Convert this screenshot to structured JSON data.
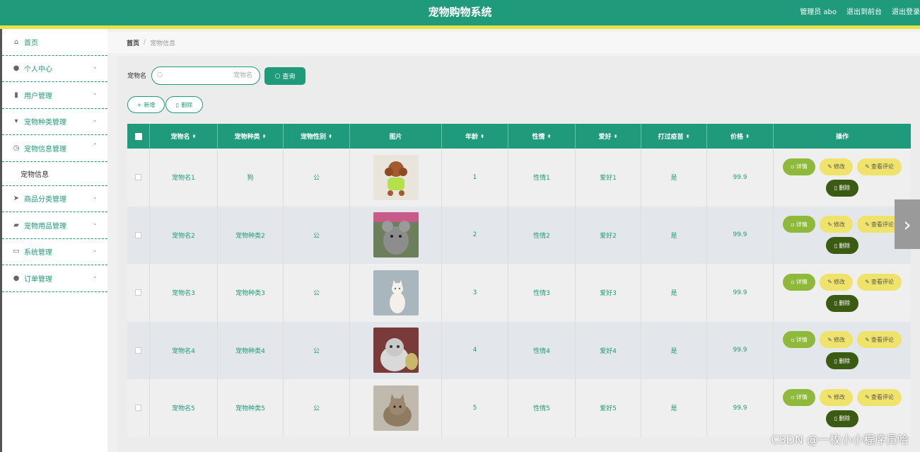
{
  "header": {
    "title": "宠物购物系统",
    "admin": "管理员 abo",
    "back_front": "退出到前台",
    "logout": "退出登录",
    "accent": "#1f9a7a",
    "stripe": "#e8e24a"
  },
  "sidebar": {
    "items": [
      {
        "label": "首页",
        "icon": "home-icon"
      },
      {
        "label": "个人中心",
        "icon": "user-icon"
      },
      {
        "label": "用户管理",
        "icon": "users-icon"
      },
      {
        "label": "宠物种类管理",
        "icon": "category-icon"
      },
      {
        "label": "宠物信息管理",
        "icon": "clock-icon"
      },
      {
        "label": "宠物信息",
        "icon": ""
      },
      {
        "label": "商品分类管理",
        "icon": "send-icon"
      },
      {
        "label": "宠物用品管理",
        "icon": "goods-icon"
      },
      {
        "label": "系统管理",
        "icon": "chat-icon"
      },
      {
        "label": "订单管理",
        "icon": "order-icon"
      }
    ]
  },
  "breadcrumb": {
    "home": "首页",
    "sep": "/",
    "current": "宠物信息"
  },
  "search": {
    "label": "宠物名",
    "placeholder": "宠物名",
    "button": "查询"
  },
  "actions": {
    "add": "新增",
    "delete": "删除"
  },
  "table": {
    "headers": [
      "宠物名",
      "宠物种类",
      "宠物性别",
      "图片",
      "年龄",
      "性情",
      "爱好",
      "打过疫苗",
      "价格",
      "操作"
    ],
    "op_labels": {
      "detail": "详情",
      "edit": "修改",
      "review": "查看评论",
      "delete": "删除"
    },
    "rows": [
      {
        "name": "宠物名1",
        "kind": "狗",
        "gender": "公",
        "age": "1",
        "temper": "性情1",
        "hobby": "爱好1",
        "vaccine": "是",
        "price": "99.9",
        "img": "poodle"
      },
      {
        "name": "宠物名2",
        "kind": "宠物种类2",
        "gender": "公",
        "age": "2",
        "temper": "性情2",
        "hobby": "爱好2",
        "vaccine": "是",
        "price": "99.9",
        "img": "chinchilla"
      },
      {
        "name": "宠物名3",
        "kind": "宠物种类3",
        "gender": "公",
        "age": "3",
        "temper": "性情3",
        "hobby": "爱好3",
        "vaccine": "是",
        "price": "99.9",
        "img": "white-cat"
      },
      {
        "name": "宠物名4",
        "kind": "宠物种类4",
        "gender": "公",
        "age": "4",
        "temper": "性情4",
        "hobby": "爱好4",
        "vaccine": "是",
        "price": "99.9",
        "img": "grey-cat"
      },
      {
        "name": "宠物名5",
        "kind": "宠物种类5",
        "gender": "公",
        "age": "5",
        "temper": "性情5",
        "hobby": "爱好5",
        "vaccine": "是",
        "price": "99.9",
        "img": "tabby-cat"
      }
    ]
  },
  "watermark": "CSDN @一枚小小程序员哈"
}
